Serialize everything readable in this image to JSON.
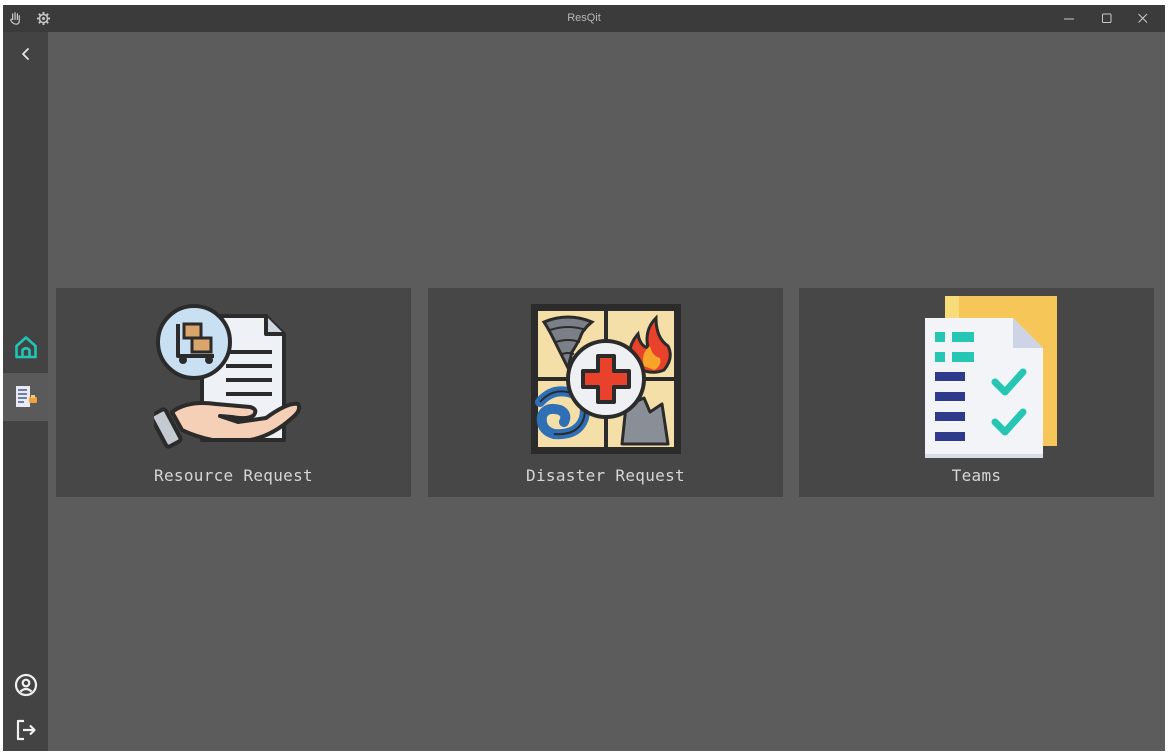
{
  "window": {
    "title": "ResQit"
  },
  "titlebar": {
    "left_icons": [
      "hand-icon",
      "gear-icon"
    ],
    "controls": [
      "minimize-icon",
      "maximize-icon",
      "close-icon"
    ]
  },
  "sidebar": {
    "items": [
      {
        "icon": "chevron-left-icon"
      },
      {
        "icon": "home-icon"
      },
      {
        "icon": "requests-icon",
        "active": true
      },
      {
        "icon": "user-circle-icon"
      },
      {
        "icon": "logout-icon"
      }
    ]
  },
  "cards": [
    {
      "label": "Resource Request",
      "icon": "resource-request-icon"
    },
    {
      "label": "Disaster Request",
      "icon": "disaster-request-icon"
    },
    {
      "label": "Teams",
      "icon": "teams-icon"
    }
  ],
  "colors": {
    "window_bg": "#5c5c5c",
    "titlebar_bg": "#3b3b3b",
    "sidebar_bg": "#434343",
    "card_bg": "#474747",
    "home_accent": "#21c5b5"
  }
}
